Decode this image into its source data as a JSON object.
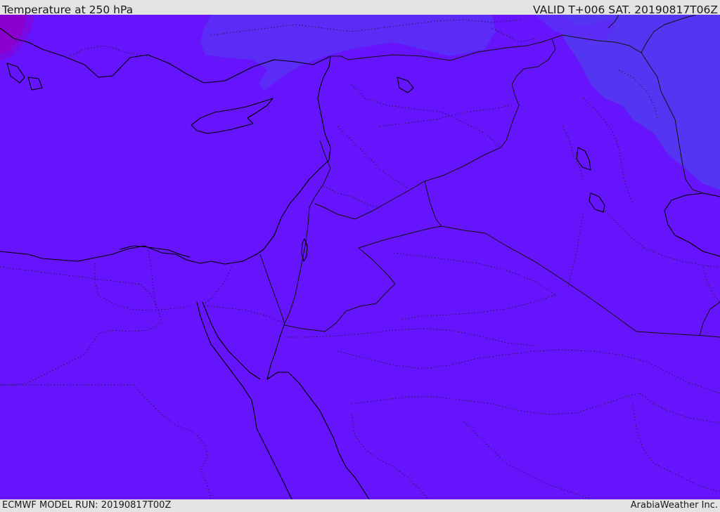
{
  "header": {
    "title": "Temperature at 250 hPa",
    "valid": "VALID T+006 SAT. 20190817T06Z"
  },
  "footer": {
    "run": "ECMWF MODEL RUN: 20190817T00Z",
    "credit": "ArabiaWeather Inc."
  },
  "colors": {
    "field_main": "#6614fb",
    "field_cool_north": "#5a2cf6",
    "field_coolest_east": "#5436f2",
    "field_warm_northwest": "#8a00cf",
    "coastline": "#000000",
    "borders": "#1a1a40"
  }
}
